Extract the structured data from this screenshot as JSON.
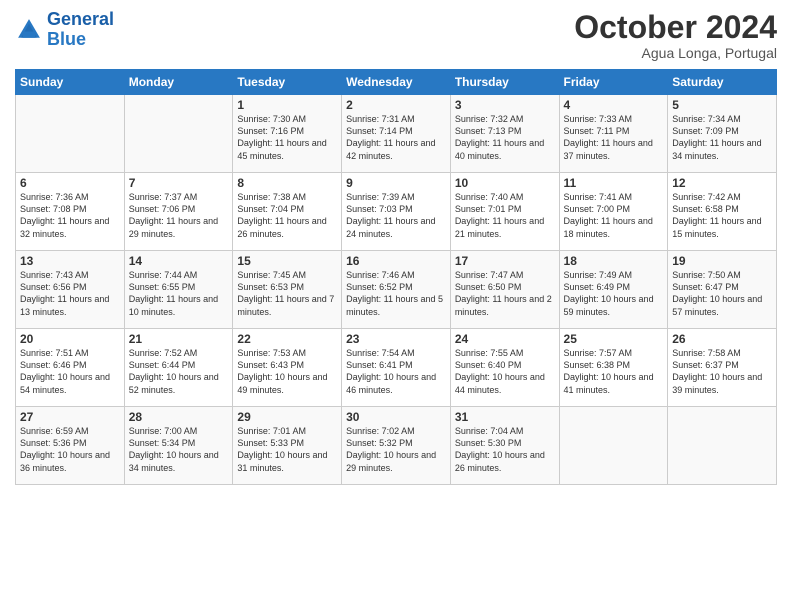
{
  "logo": {
    "line1": "General",
    "line2": "Blue"
  },
  "title": "October 2024",
  "subtitle": "Agua Longa, Portugal",
  "days_of_week": [
    "Sunday",
    "Monday",
    "Tuesday",
    "Wednesday",
    "Thursday",
    "Friday",
    "Saturday"
  ],
  "weeks": [
    [
      {
        "day": "",
        "info": ""
      },
      {
        "day": "",
        "info": ""
      },
      {
        "day": "1",
        "info": "Sunrise: 7:30 AM\nSunset: 7:16 PM\nDaylight: 11 hours and 45 minutes."
      },
      {
        "day": "2",
        "info": "Sunrise: 7:31 AM\nSunset: 7:14 PM\nDaylight: 11 hours and 42 minutes."
      },
      {
        "day": "3",
        "info": "Sunrise: 7:32 AM\nSunset: 7:13 PM\nDaylight: 11 hours and 40 minutes."
      },
      {
        "day": "4",
        "info": "Sunrise: 7:33 AM\nSunset: 7:11 PM\nDaylight: 11 hours and 37 minutes."
      },
      {
        "day": "5",
        "info": "Sunrise: 7:34 AM\nSunset: 7:09 PM\nDaylight: 11 hours and 34 minutes."
      }
    ],
    [
      {
        "day": "6",
        "info": "Sunrise: 7:36 AM\nSunset: 7:08 PM\nDaylight: 11 hours and 32 minutes."
      },
      {
        "day": "7",
        "info": "Sunrise: 7:37 AM\nSunset: 7:06 PM\nDaylight: 11 hours and 29 minutes."
      },
      {
        "day": "8",
        "info": "Sunrise: 7:38 AM\nSunset: 7:04 PM\nDaylight: 11 hours and 26 minutes."
      },
      {
        "day": "9",
        "info": "Sunrise: 7:39 AM\nSunset: 7:03 PM\nDaylight: 11 hours and 24 minutes."
      },
      {
        "day": "10",
        "info": "Sunrise: 7:40 AM\nSunset: 7:01 PM\nDaylight: 11 hours and 21 minutes."
      },
      {
        "day": "11",
        "info": "Sunrise: 7:41 AM\nSunset: 7:00 PM\nDaylight: 11 hours and 18 minutes."
      },
      {
        "day": "12",
        "info": "Sunrise: 7:42 AM\nSunset: 6:58 PM\nDaylight: 11 hours and 15 minutes."
      }
    ],
    [
      {
        "day": "13",
        "info": "Sunrise: 7:43 AM\nSunset: 6:56 PM\nDaylight: 11 hours and 13 minutes."
      },
      {
        "day": "14",
        "info": "Sunrise: 7:44 AM\nSunset: 6:55 PM\nDaylight: 11 hours and 10 minutes."
      },
      {
        "day": "15",
        "info": "Sunrise: 7:45 AM\nSunset: 6:53 PM\nDaylight: 11 hours and 7 minutes."
      },
      {
        "day": "16",
        "info": "Sunrise: 7:46 AM\nSunset: 6:52 PM\nDaylight: 11 hours and 5 minutes."
      },
      {
        "day": "17",
        "info": "Sunrise: 7:47 AM\nSunset: 6:50 PM\nDaylight: 11 hours and 2 minutes."
      },
      {
        "day": "18",
        "info": "Sunrise: 7:49 AM\nSunset: 6:49 PM\nDaylight: 10 hours and 59 minutes."
      },
      {
        "day": "19",
        "info": "Sunrise: 7:50 AM\nSunset: 6:47 PM\nDaylight: 10 hours and 57 minutes."
      }
    ],
    [
      {
        "day": "20",
        "info": "Sunrise: 7:51 AM\nSunset: 6:46 PM\nDaylight: 10 hours and 54 minutes."
      },
      {
        "day": "21",
        "info": "Sunrise: 7:52 AM\nSunset: 6:44 PM\nDaylight: 10 hours and 52 minutes."
      },
      {
        "day": "22",
        "info": "Sunrise: 7:53 AM\nSunset: 6:43 PM\nDaylight: 10 hours and 49 minutes."
      },
      {
        "day": "23",
        "info": "Sunrise: 7:54 AM\nSunset: 6:41 PM\nDaylight: 10 hours and 46 minutes."
      },
      {
        "day": "24",
        "info": "Sunrise: 7:55 AM\nSunset: 6:40 PM\nDaylight: 10 hours and 44 minutes."
      },
      {
        "day": "25",
        "info": "Sunrise: 7:57 AM\nSunset: 6:38 PM\nDaylight: 10 hours and 41 minutes."
      },
      {
        "day": "26",
        "info": "Sunrise: 7:58 AM\nSunset: 6:37 PM\nDaylight: 10 hours and 39 minutes."
      }
    ],
    [
      {
        "day": "27",
        "info": "Sunrise: 6:59 AM\nSunset: 5:36 PM\nDaylight: 10 hours and 36 minutes."
      },
      {
        "day": "28",
        "info": "Sunrise: 7:00 AM\nSunset: 5:34 PM\nDaylight: 10 hours and 34 minutes."
      },
      {
        "day": "29",
        "info": "Sunrise: 7:01 AM\nSunset: 5:33 PM\nDaylight: 10 hours and 31 minutes."
      },
      {
        "day": "30",
        "info": "Sunrise: 7:02 AM\nSunset: 5:32 PM\nDaylight: 10 hours and 29 minutes."
      },
      {
        "day": "31",
        "info": "Sunrise: 7:04 AM\nSunset: 5:30 PM\nDaylight: 10 hours and 26 minutes."
      },
      {
        "day": "",
        "info": ""
      },
      {
        "day": "",
        "info": ""
      }
    ]
  ]
}
